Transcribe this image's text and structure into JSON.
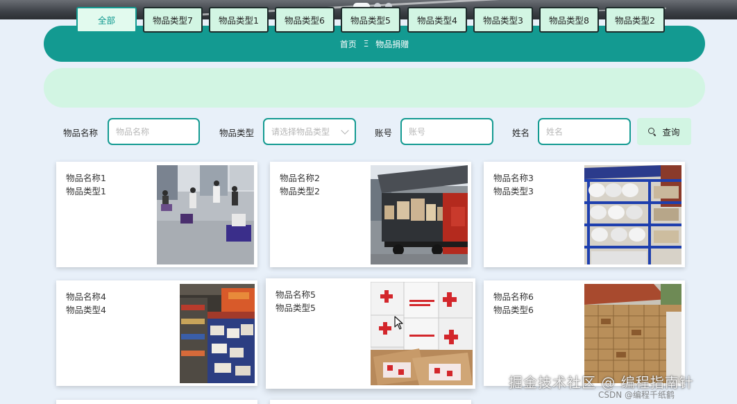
{
  "carousel": {
    "slide_count": 3,
    "active_index": 0
  },
  "nav": {
    "home": "首页",
    "separator": "Ξ",
    "current": "物品捐赠"
  },
  "types": [
    "全部",
    "物品类型7",
    "物品类型1",
    "物品类型6",
    "物品类型5",
    "物品类型4",
    "物品类型3",
    "物品类型8",
    "物品类型2"
  ],
  "search": {
    "name_label": "物品名称",
    "name_placeholder": "物品名称",
    "type_label": "物品类型",
    "type_placeholder": "请选择物品类型",
    "account_label": "账号",
    "account_placeholder": "账号",
    "person_label": "姓名",
    "person_placeholder": "姓名",
    "query_label": "查询"
  },
  "cards": [
    {
      "name": "物品名称1",
      "type": "物品类型1",
      "photo": "volunteers-outdoor-photo"
    },
    {
      "name": "物品名称2",
      "type": "物品类型2",
      "photo": "cargo-truck-photo"
    },
    {
      "name": "物品名称3",
      "type": "物品类型3",
      "photo": "shelf-supplies-photo"
    },
    {
      "name": "物品名称4",
      "type": "物品类型4",
      "photo": "supermarket-aisle-photo"
    },
    {
      "name": "物品名称5",
      "type": "物品类型5",
      "photo": "red-cross-boxes-photo"
    },
    {
      "name": "物品名称6",
      "type": "物品类型6",
      "photo": "cardboard-boxes-photo"
    }
  ],
  "watermark": {
    "main": "掘金技术社区 @ 编程指南针",
    "sub": "CSDN @编程千纸鹤"
  },
  "colors": {
    "primary": "#139a91",
    "mint": "#d2f5e3",
    "page_bg": "#e8f0f9"
  }
}
